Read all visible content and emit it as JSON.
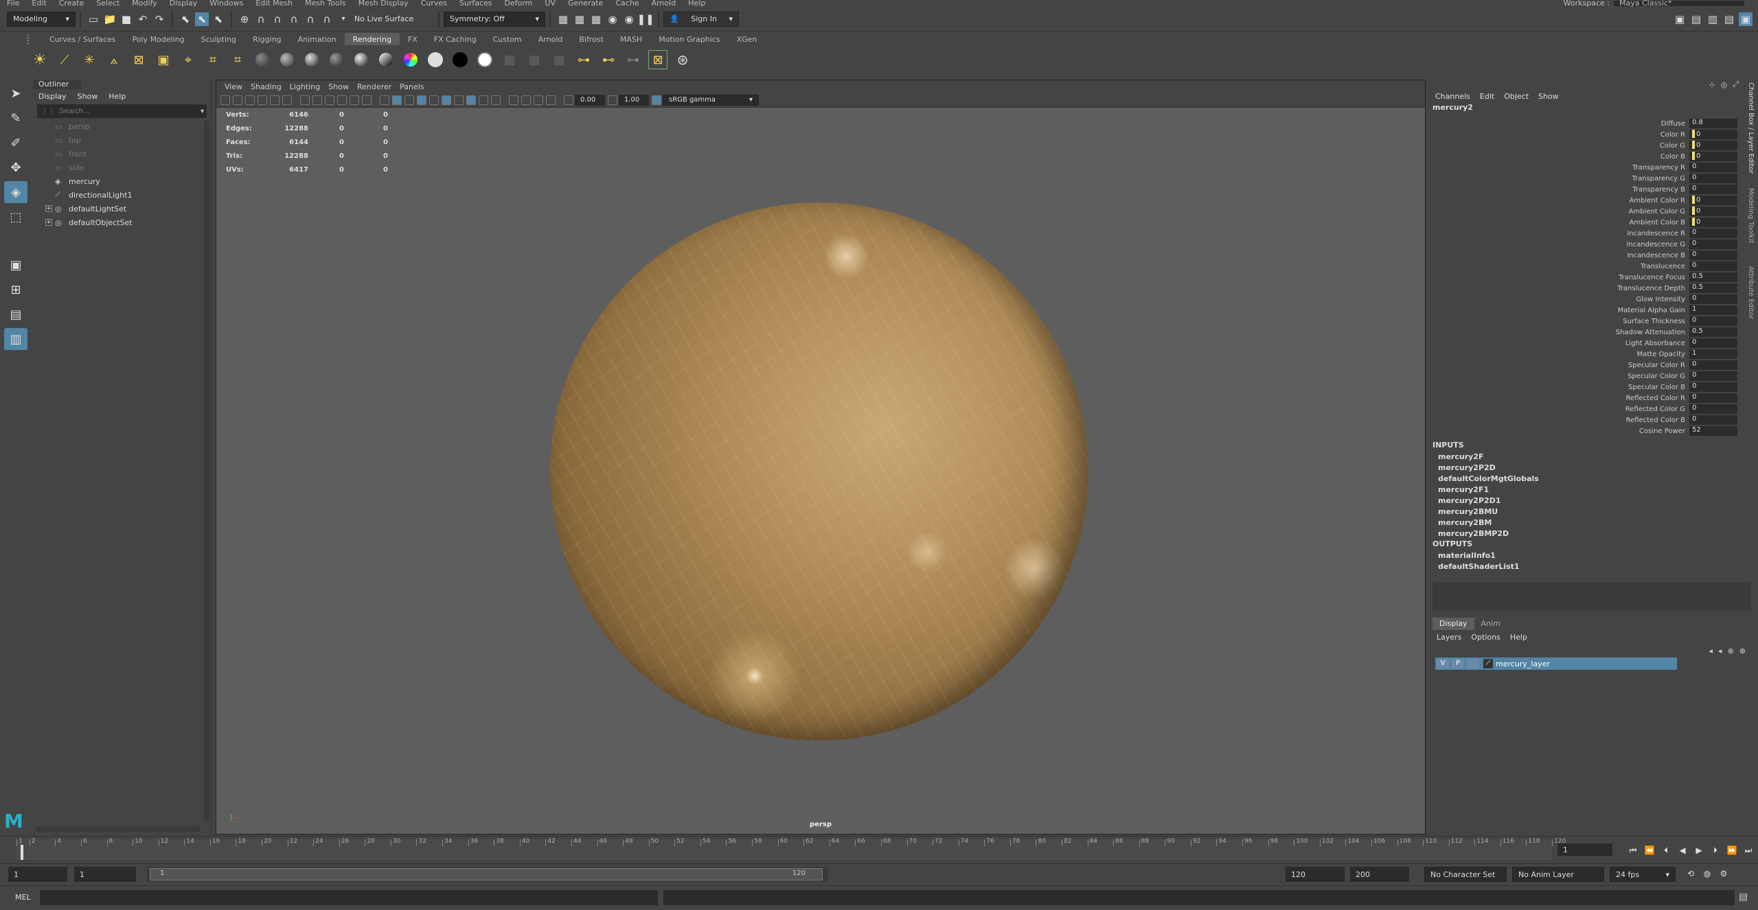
{
  "statusline": {
    "mode": "Modeling",
    "live_surface": "No Live Surface",
    "symmetry": "Symmetry: Off",
    "sign_in": "Sign In",
    "workspace_label": "Workspace :",
    "workspace_value": "Maya Classic*"
  },
  "shelf_tabs": [
    "Curves / Surfaces",
    "Poly Modeling",
    "Sculpting",
    "Rigging",
    "Animation",
    "Rendering",
    "FX",
    "FX Caching",
    "Custom",
    "Arnold",
    "Bifrost",
    "MASH",
    "Motion Graphics",
    "XGen"
  ],
  "shelf_active": "Rendering",
  "outliner": {
    "title": "Outliner",
    "menu": [
      "Display",
      "Show",
      "Help"
    ],
    "search_placeholder": "Search...",
    "items": [
      {
        "label": "persp",
        "dim": true
      },
      {
        "label": "top",
        "dim": true
      },
      {
        "label": "front",
        "dim": true
      },
      {
        "label": "side",
        "dim": true
      },
      {
        "label": "mercury",
        "dim": false
      },
      {
        "label": "directionalLight1",
        "dim": false
      },
      {
        "label": "defaultLightSet",
        "dim": false
      },
      {
        "label": "defaultObjectSet",
        "dim": false
      }
    ]
  },
  "viewport": {
    "menu": [
      "View",
      "Shading",
      "Lighting",
      "Show",
      "Renderer",
      "Panels"
    ],
    "exposure": "0.00",
    "gamma": "1.00",
    "color_space": "sRGB gamma",
    "camera_label": "persp",
    "hud": [
      {
        "label": "Verts:",
        "v1": "6146",
        "v2": "0",
        "v3": "0"
      },
      {
        "label": "Edges:",
        "v1": "12288",
        "v2": "0",
        "v3": "0"
      },
      {
        "label": "Faces:",
        "v1": "6144",
        "v2": "0",
        "v3": "0"
      },
      {
        "label": "Tris:",
        "v1": "12288",
        "v2": "0",
        "v3": "0"
      },
      {
        "label": "UVs:",
        "v1": "6417",
        "v2": "0",
        "v3": "0"
      }
    ]
  },
  "channelbox": {
    "menu": [
      "Channels",
      "Edit",
      "Object",
      "Show"
    ],
    "node_name": "mercury2",
    "attributes": [
      {
        "name": "Diffuse",
        "value": "0.8",
        "swatch": false
      },
      {
        "name": "Color R",
        "value": "0",
        "swatch": true
      },
      {
        "name": "Color G",
        "value": "0",
        "swatch": true
      },
      {
        "name": "Color B",
        "value": "0",
        "swatch": true
      },
      {
        "name": "Transparency R",
        "value": "0",
        "swatch": false
      },
      {
        "name": "Transparency G",
        "value": "0",
        "swatch": false
      },
      {
        "name": "Transparency B",
        "value": "0",
        "swatch": false
      },
      {
        "name": "Ambient Color R",
        "value": "0",
        "swatch": true
      },
      {
        "name": "Ambient Color G",
        "value": "0",
        "swatch": true
      },
      {
        "name": "Ambient Color B",
        "value": "0",
        "swatch": true
      },
      {
        "name": "Incandescence R",
        "value": "0",
        "swatch": false
      },
      {
        "name": "Incandescence G",
        "value": "0",
        "swatch": false
      },
      {
        "name": "Incandescence B",
        "value": "0",
        "swatch": false
      },
      {
        "name": "Translucence",
        "value": "0",
        "swatch": false
      },
      {
        "name": "Translucence Focus",
        "value": "0.5",
        "swatch": false
      },
      {
        "name": "Translucence Depth",
        "value": "0.5",
        "swatch": false
      },
      {
        "name": "Glow Intensity",
        "value": "0",
        "swatch": false
      },
      {
        "name": "Material Alpha Gain",
        "value": "1",
        "swatch": false
      },
      {
        "name": "Surface Thickness",
        "value": "0",
        "swatch": false
      },
      {
        "name": "Shadow Attenuation",
        "value": "0.5",
        "swatch": false
      },
      {
        "name": "Light Absorbance",
        "value": "0",
        "swatch": false
      },
      {
        "name": "Matte Opacity",
        "value": "1",
        "swatch": false
      },
      {
        "name": "Specular Color R",
        "value": "0",
        "swatch": false
      },
      {
        "name": "Specular Color G",
        "value": "0",
        "swatch": false
      },
      {
        "name": "Specular Color B",
        "value": "0",
        "swatch": false
      },
      {
        "name": "Reflected Color R",
        "value": "0",
        "swatch": false
      },
      {
        "name": "Reflected Color G",
        "value": "0",
        "swatch": false
      },
      {
        "name": "Reflected Color B",
        "value": "0",
        "swatch": false
      },
      {
        "name": "Cosine Power",
        "value": "52",
        "swatch": false
      }
    ],
    "inputs_label": "INPUTS",
    "inputs": [
      "mercury2F",
      "mercury2P2D",
      "defaultColorMgtGlobals",
      "mercury2F1",
      "mercury2P2D1",
      "mercury2BMU",
      "mercury2BM",
      "mercury2BMP2D"
    ],
    "outputs_label": "OUTPUTS",
    "outputs": [
      "materialInfo1",
      "defaultShaderList1"
    ],
    "side_tabs": [
      "Channel Box / Layer Editor",
      "Modeling Toolkit",
      "Attribute Editor"
    ]
  },
  "layer_editor": {
    "tabs": [
      "Display",
      "Anim"
    ],
    "menu": [
      "Layers",
      "Options",
      "Help"
    ],
    "layer": {
      "v": "V",
      "p": "P",
      "name": "mercury_layer"
    }
  },
  "timeline": {
    "ticks": [
      "1",
      "2",
      "4",
      "6",
      "8",
      "10",
      "12",
      "14",
      "16",
      "18",
      "20",
      "22",
      "24",
      "26",
      "28",
      "30",
      "32",
      "34",
      "36",
      "38",
      "40",
      "42",
      "44",
      "46",
      "48",
      "50",
      "52",
      "54",
      "56",
      "58",
      "60",
      "62",
      "64",
      "66",
      "68",
      "70",
      "72",
      "74",
      "76",
      "78",
      "80",
      "82",
      "84",
      "86",
      "88",
      "90",
      "92",
      "94",
      "96",
      "98",
      "100",
      "102",
      "104",
      "106",
      "108",
      "110",
      "112",
      "114",
      "116",
      "118",
      "120"
    ],
    "current_frame": "1"
  },
  "rangebar": {
    "start": "1",
    "play_start": "1",
    "slider_start": "1",
    "slider_end": "120",
    "play_end": "120",
    "end": "200",
    "character_set": "No Character Set",
    "anim_layer": "No Anim Layer",
    "fps": "24 fps"
  },
  "cmdline": {
    "label": "MEL"
  },
  "colors": {
    "accent": "#5285a6",
    "swatch": "#f0e070"
  }
}
